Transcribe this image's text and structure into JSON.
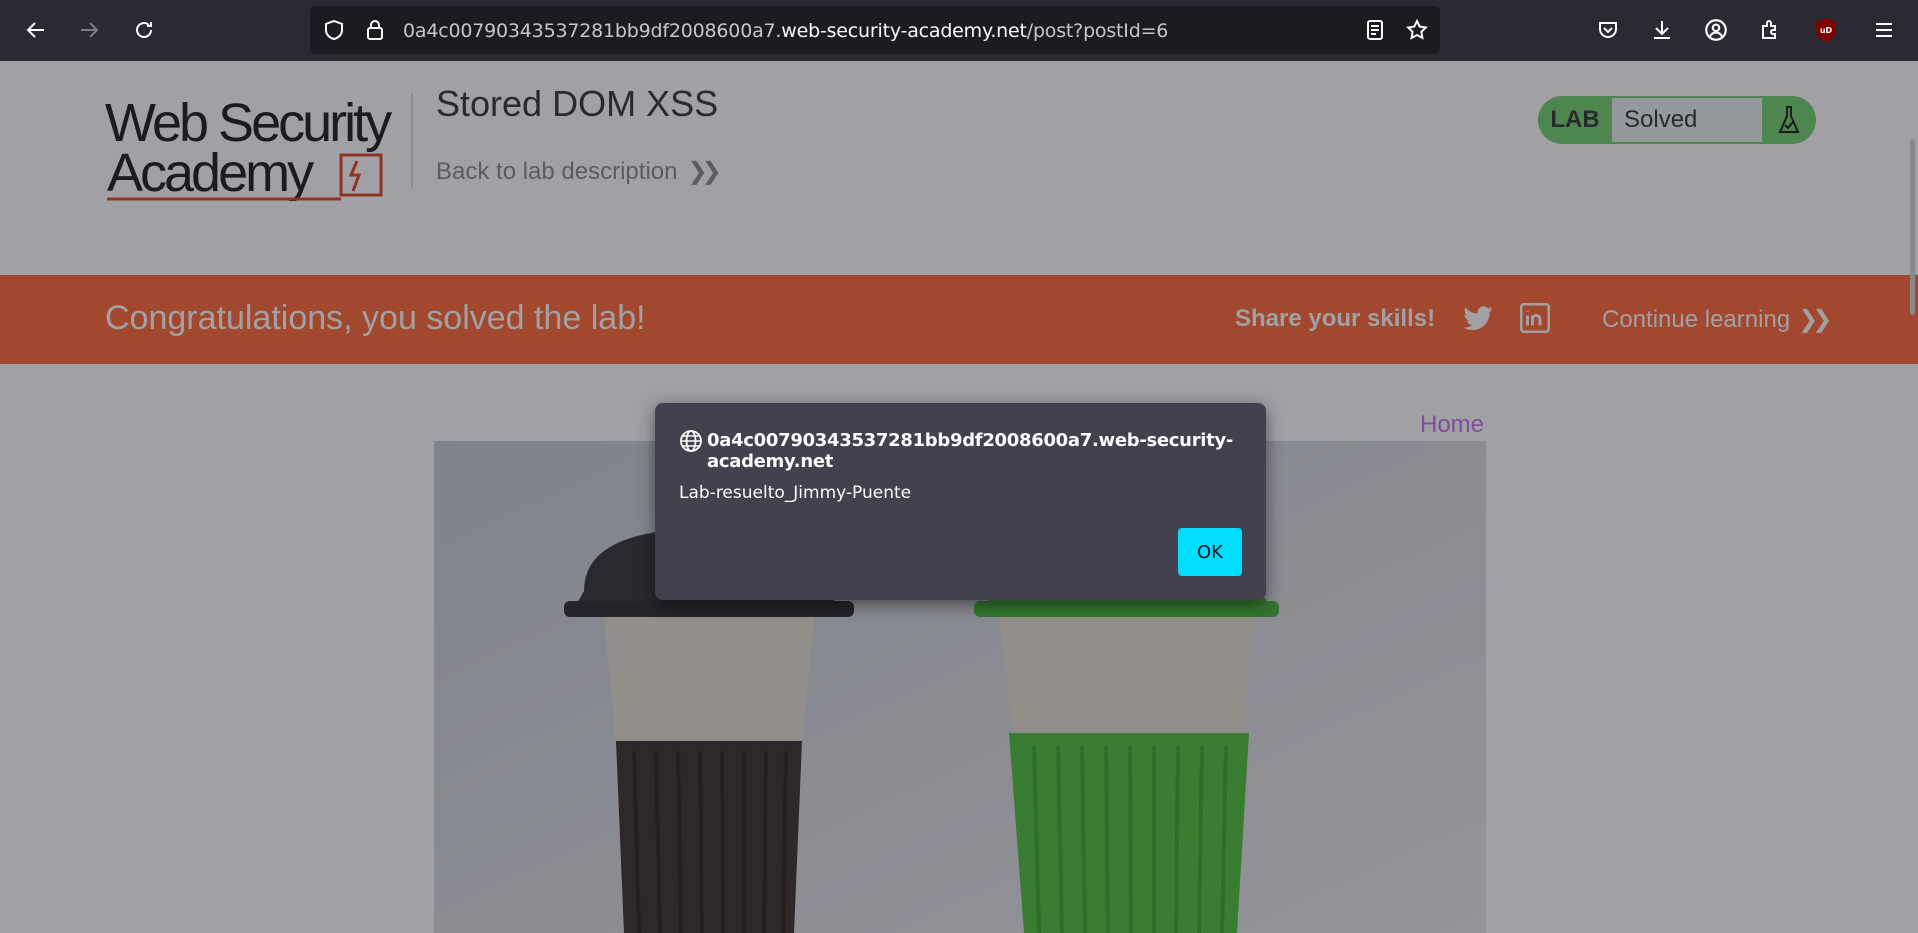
{
  "browser": {
    "url_prefix": "0a4c00790343537281bb9df2008600a7.",
    "url_domain": "web-security-academy.net",
    "url_path": "/post?postId=6"
  },
  "header": {
    "logo_line1": "Web Security",
    "logo_line2": "Academy",
    "lab_title": "Stored DOM XSS",
    "back_link": "Back to lab description",
    "badge_lab": "LAB",
    "badge_status": "Solved"
  },
  "banner": {
    "congrats": "Congratulations, you solved the lab!",
    "share": "Share your skills!",
    "continue": "Continue learning"
  },
  "nav": {
    "home": "Home"
  },
  "dialog": {
    "origin": "0a4c00790343537281bb9df2008600a7.web-security-academy.net",
    "message": "Lab-resuelto_Jimmy-Puente",
    "ok_label": "OK"
  },
  "colors": {
    "banner": "#ff6633",
    "badge": "#70d16d",
    "ok_button": "#00ddff",
    "home_link": "#c471ed"
  }
}
